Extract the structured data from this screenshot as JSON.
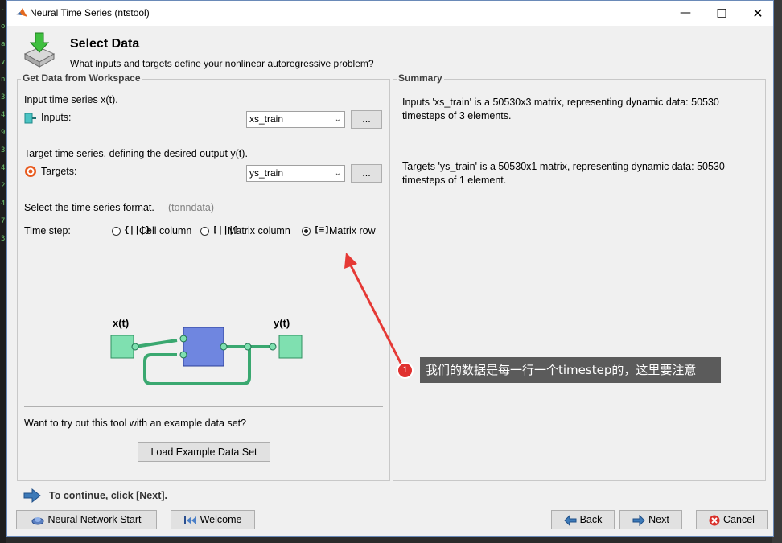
{
  "window": {
    "title": "Neural Time Series (ntstool)"
  },
  "header": {
    "title": "Select Data",
    "subtitle": "What inputs and targets define your nonlinear autoregressive problem?"
  },
  "left_panel": {
    "legend": "Get Data from Workspace",
    "input_caption": "Input time series x(t).",
    "inputs_label": "Inputs:",
    "inputs_value": "xs_train",
    "browse_label": "...",
    "target_caption": "Target time series, defining the desired output y(t).",
    "targets_label": "Targets:",
    "targets_value": "ys_train",
    "format_caption": "Select the time series format.",
    "format_hint": "(tonndata)",
    "timestep_label": "Time step:",
    "formats": [
      {
        "label": "Cell column",
        "icon": "{|||}",
        "selected": false
      },
      {
        "label": "Matrix column",
        "icon": "[|||]",
        "selected": false
      },
      {
        "label": "Matrix row",
        "icon": "[≡]",
        "selected": true
      }
    ],
    "diagram": {
      "x_label": "x(t)",
      "y_label": "y(t)"
    },
    "example_caption": "Want to try out this tool with an example data set?",
    "load_example_label": "Load Example Data Set"
  },
  "summary": {
    "legend": "Summary",
    "inputs_text": "Inputs 'xs_train' is a 50530x3 matrix, representing dynamic data: 50530 timesteps of 3 elements.",
    "targets_text": "Targets 'ys_train' is a 50530x1 matrix, representing dynamic data: 50530 timesteps of 1 element."
  },
  "footer": {
    "hint": "To continue, click [Next].",
    "nn_start_label": "Neural Network Start",
    "welcome_label": "Welcome",
    "back_label": "Back",
    "next_label": "Next",
    "cancel_label": "Cancel"
  },
  "annotation": {
    "badge": "1",
    "text": "我们的数据是每一行一个timestep的，这里要注意",
    "arrow_color": "#e53935"
  },
  "colors": {
    "accent": "#3d7ab8",
    "block_fill": "#7fe0b0",
    "net_fill": "#6f86e0"
  }
}
